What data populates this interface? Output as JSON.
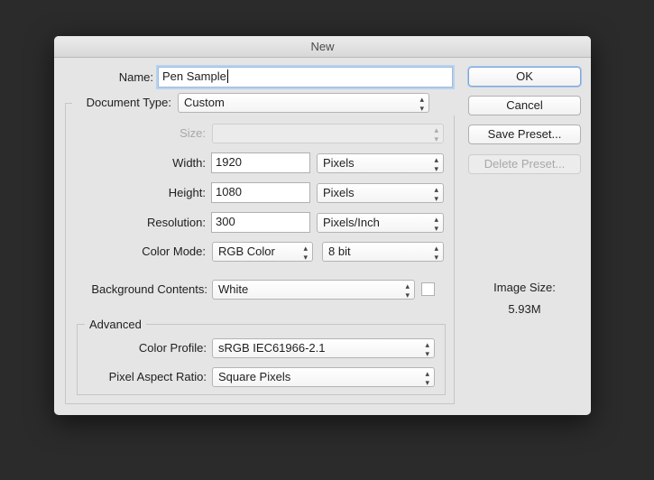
{
  "window": {
    "title": "New"
  },
  "name": {
    "label": "Name:",
    "value": "Pen Sample"
  },
  "document_type": {
    "label": "Document Type:",
    "value": "Custom"
  },
  "size": {
    "label": "Size:",
    "value": ""
  },
  "width": {
    "label": "Width:",
    "value": "1920",
    "unit": "Pixels"
  },
  "height": {
    "label": "Height:",
    "value": "1080",
    "unit": "Pixels"
  },
  "resolution": {
    "label": "Resolution:",
    "value": "300",
    "unit": "Pixels/Inch"
  },
  "color_mode": {
    "label": "Color Mode:",
    "value": "RGB Color",
    "depth": "8 bit"
  },
  "background": {
    "label": "Background Contents:",
    "value": "White",
    "swatch_color": "#ffffff"
  },
  "advanced": {
    "title": "Advanced",
    "color_profile_label": "Color Profile:",
    "color_profile": "sRGB IEC61966-2.1",
    "pixel_aspect_label": "Pixel Aspect Ratio:",
    "pixel_aspect": "Square Pixels"
  },
  "buttons": {
    "ok": "OK",
    "cancel": "Cancel",
    "save_preset": "Save Preset...",
    "delete_preset": "Delete Preset..."
  },
  "image_size": {
    "label": "Image Size:",
    "value": "5.93M"
  }
}
